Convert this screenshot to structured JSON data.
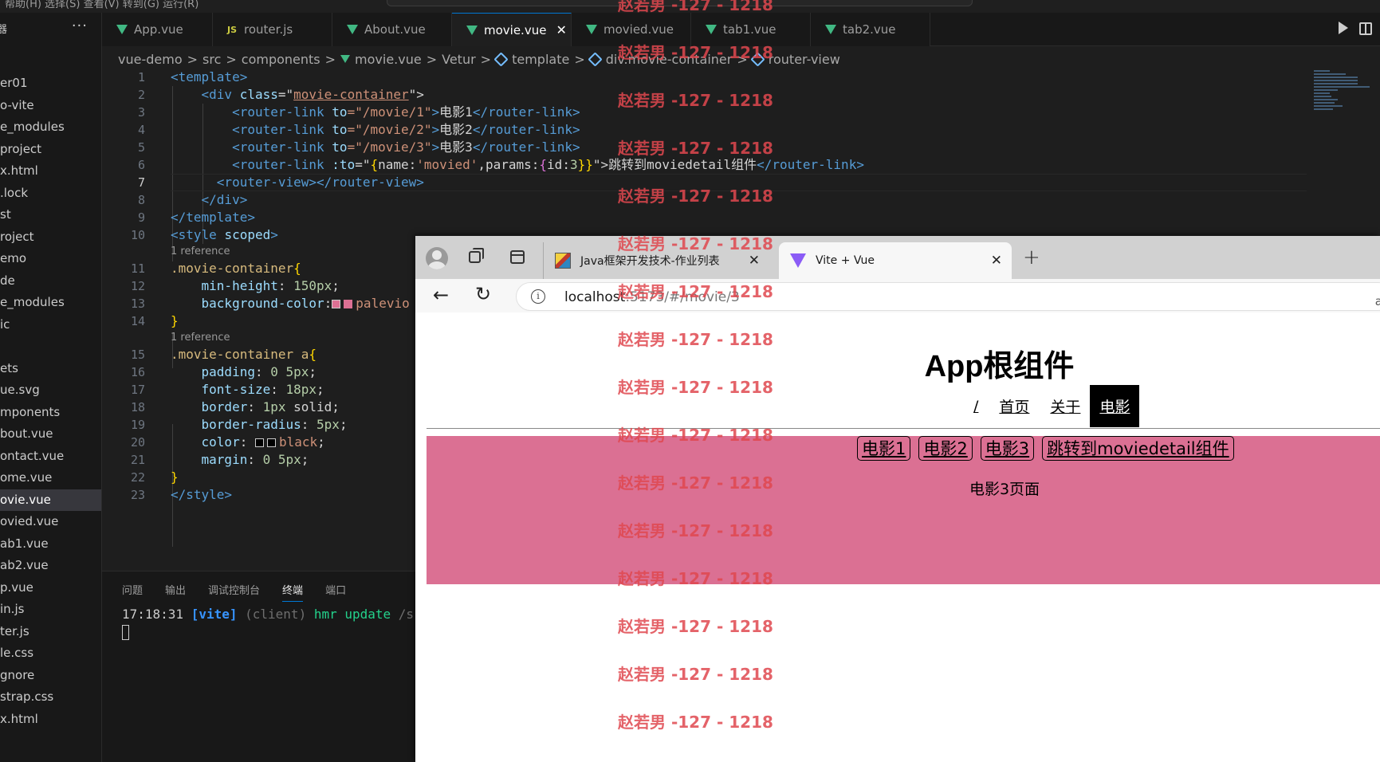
{
  "titlebar": {
    "crumbs": "帮助(H)    选择(S)    查看(V)    转到(G)    运行(R)"
  },
  "explorer": {
    "title": "器",
    "more": "···",
    "items": [
      "er01",
      "o-vite",
      "e_modules",
      "project",
      "x.html",
      ".lock",
      "st",
      "roject",
      "emo",
      "de",
      "e_modules",
      "ic",
      "",
      "ets",
      "ue.svg",
      "mponents",
      "bout.vue",
      "ontact.vue",
      "ome.vue",
      "ovie.vue",
      "ovied.vue",
      "ab1.vue",
      "ab2.vue",
      "p.vue",
      "in.js",
      "ter.js",
      "le.css",
      "gnore",
      "strap.css",
      "x.html"
    ],
    "active_index": 19
  },
  "tabs": [
    {
      "label": "App.vue",
      "icon": "vue-icon"
    },
    {
      "label": "router.js",
      "icon": "js-icon",
      "icon_text": "JS"
    },
    {
      "label": "About.vue",
      "icon": "vue-icon"
    },
    {
      "label": "movie.vue",
      "icon": "vue-icon",
      "active": true,
      "close": "✕"
    },
    {
      "label": "movied.vue",
      "icon": "vue-icon"
    },
    {
      "label": "tab1.vue",
      "icon": "vue-icon"
    },
    {
      "label": "tab2.vue",
      "icon": "vue-icon"
    }
  ],
  "breadcrumb": {
    "parts": [
      "vue-demo",
      "src",
      "components",
      "movie.vue",
      "Vetur",
      "template",
      "div.movie-container",
      "router-view"
    ],
    "sep": ">"
  },
  "editor": {
    "current_line": 7,
    "line_numbers": [
      "1",
      "2",
      "3",
      "4",
      "5",
      "6",
      "7",
      "8",
      "9",
      "10",
      "11",
      "12",
      "13",
      "14",
      "15",
      "16",
      "17",
      "18",
      "19",
      "20",
      "21",
      "22",
      "23"
    ],
    "code": {
      "l1": "<template>",
      "l2_a": "<div ",
      "l2_b": "class",
      "l2_c": "=\"",
      "l2_d": "movie-container",
      "l2_e": "\">",
      "l3_a": "<router-link ",
      "l3_b": "to",
      "l3_c": "=\"/movie/1\"",
      "l3_d": ">",
      "l3_e": "电影1",
      "l3_f": "</router-link>",
      "l4_c": "=\"/movie/2\"",
      "l4_e": "电影2",
      "l5_c": "=\"/movie/3\"",
      "l5_e": "电影3",
      "l6_b": ":to",
      "l6_c1": "=\"",
      "l6_c2": "{",
      "l6_c3": "name:",
      "l6_c4": "'movied'",
      "l6_c5": ",params:",
      "l6_c6": "{",
      "l6_c7": "id:",
      "l6_c8": "3",
      "l6_c9": "}}",
      "l6_c10": "\">",
      "l6_e": "跳转到moviedetail组件",
      "l7_a": "<router-view>",
      "l7_b": "</router-view>",
      "l8": "</div>",
      "l9": "</template>",
      "l10_a": "<style ",
      "l10_b": "scoped",
      "l10_c": ">",
      "ref": "1 reference",
      "l11_a": ".movie-container",
      "l11_b": "{",
      "l12_a": "min-height",
      "l12_b": ": ",
      "l12_c": "150px",
      "l12_d": ";",
      "l13_a": "background-color",
      "l13_b": ":",
      "l13_c": "palevio",
      "l14": "}",
      "l15_a": ".movie-container a",
      "l15_b": "{",
      "l16_a": "padding",
      "l16_c": "0 5px",
      "l17_a": "font-size",
      "l17_c": "18px",
      "l18_a": "border",
      "l18_c": "1px",
      "l18_d": " solid;",
      "l19_a": "border-radius",
      "l19_c": "5px",
      "l20_a": "color",
      "l20_c": "black",
      "l21_a": "margin",
      "l21_c": "0 5px",
      "l22": "}",
      "l23": "</style>"
    },
    "colors": {
      "palevioletred": "#db7093",
      "black": "#000000"
    }
  },
  "panel": {
    "tabs": [
      "问题",
      "输出",
      "调试控制台",
      "终端",
      "端口"
    ],
    "active_tab": 3,
    "term_time": "17:18:31 ",
    "term_vite": "[vite]",
    "term_client": " (client) ",
    "term_hmr": "hmr update",
    "term_path": " /src/"
  },
  "browser": {
    "tabs": [
      {
        "title": "Java框架开发技术-作业列表",
        "close": "✕"
      },
      {
        "title": "Vite + Vue",
        "close": "✕",
        "active": true
      }
    ],
    "newtab": "+",
    "url_host": "localhost",
    "url_rest": ":5173/#/movie/3",
    "read_aloud": "aあ",
    "page": {
      "title": "App根组件",
      "nav": [
        "/",
        "首页",
        "关于",
        "电影"
      ],
      "nav_active": 3,
      "movie_links": [
        "电影1",
        "电影2",
        "电影3",
        "跳转到moviedetail组件"
      ],
      "movie_text": "电影3页面",
      "accent": "#db7093"
    }
  },
  "watermark": "赵若男 -127 - 1218"
}
